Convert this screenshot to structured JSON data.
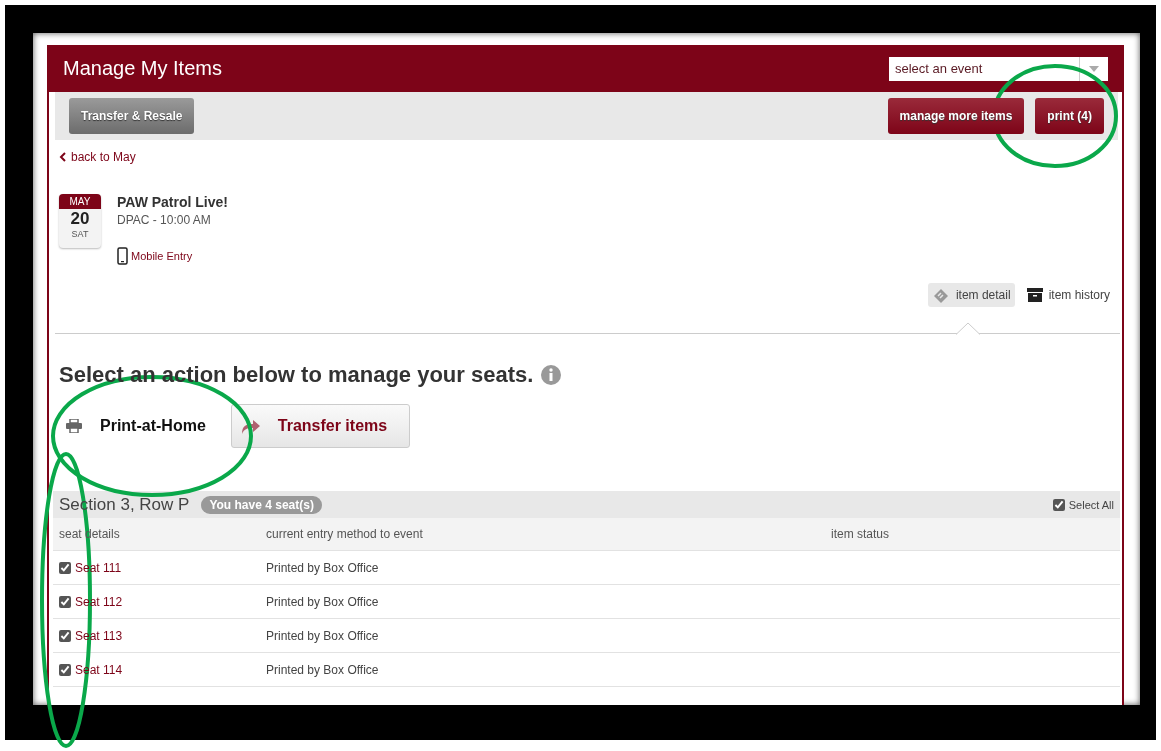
{
  "header": {
    "title": "Manage My Items",
    "event_select": {
      "placeholder": "select an event"
    }
  },
  "toolbar": {
    "left_button": "Transfer & Resale",
    "right_buttons": [
      "manage more items",
      "print (4)"
    ]
  },
  "back_link": "back to May",
  "event": {
    "month": "MAY",
    "day": "20",
    "weekday": "SAT",
    "title": "PAW Patrol Live!",
    "venue": "DPAC - 10:00 AM",
    "entry": "Mobile Entry"
  },
  "view_tabs": [
    {
      "label": "item detail",
      "selected": true,
      "kind": "detail"
    },
    {
      "label": "item history",
      "selected": false,
      "kind": "history"
    }
  ],
  "prompt": "Select an action below to manage your seats.",
  "actions": [
    {
      "label": "Print-at-Home",
      "selected": true,
      "kind": "print"
    },
    {
      "label": "Transfer items",
      "selected": false,
      "kind": "transfer"
    }
  ],
  "seats": {
    "section": "Section 3, Row P",
    "badge": "You have 4 seat(s)",
    "select_all": {
      "label": "Select All",
      "checked": true
    },
    "columns": [
      "seat details",
      "current entry method to event",
      "item status"
    ],
    "rows": [
      {
        "seat": "Seat 111",
        "entry_method": "Printed by Box Office",
        "checked": true
      },
      {
        "seat": "Seat 112",
        "entry_method": "Printed by Box Office",
        "checked": true
      },
      {
        "seat": "Seat 113",
        "entry_method": "Printed by Box Office",
        "checked": true
      },
      {
        "seat": "Seat 114",
        "entry_method": "Printed by Box Office",
        "checked": true
      }
    ]
  }
}
